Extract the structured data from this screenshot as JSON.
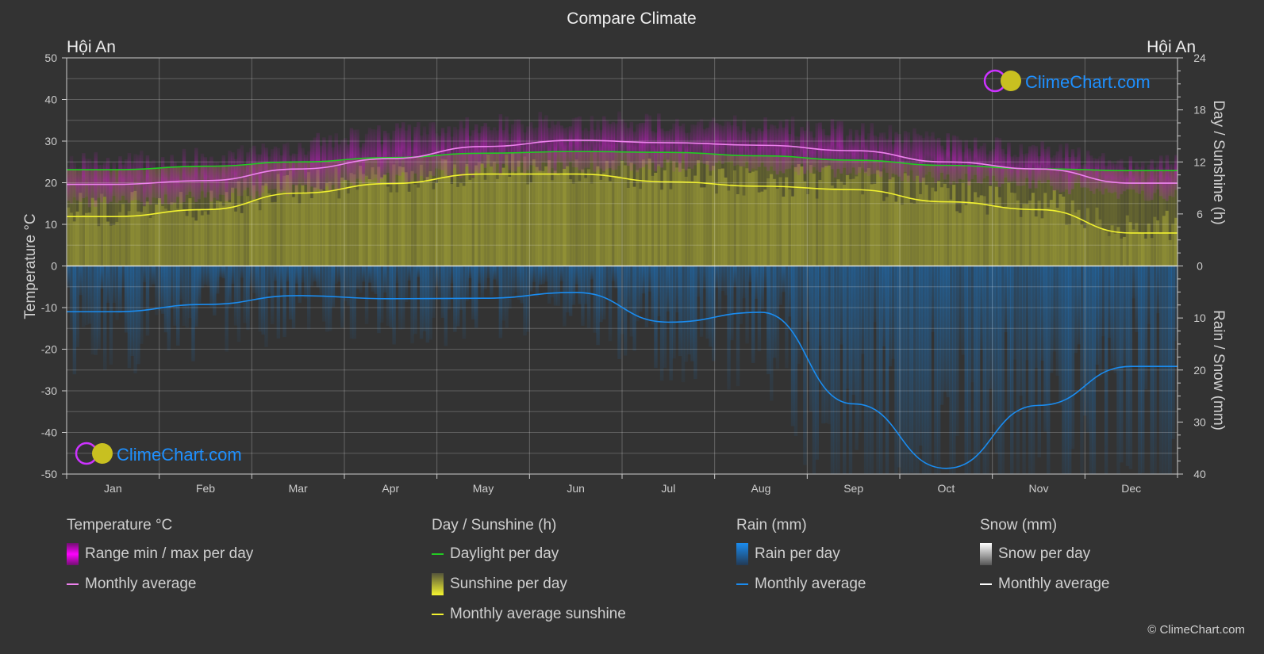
{
  "title": "Compare Climate",
  "location_left": "Hội An",
  "location_right": "Hội An",
  "watermark": "ClimeChart.com",
  "copyright": "© ClimeChart.com",
  "colors": {
    "background": "#333333",
    "temp_range": "#e000e0",
    "temp_avg": "#ee82ee",
    "daylight": "#22cc22",
    "sunshine_fill": "#d8d83a",
    "sunshine_avg": "#f2f230",
    "rain_fill": "#1e78c8",
    "rain_avg": "#1a8cf0",
    "snow_avg": "#ffffff",
    "brand_blue": "#1e90ff"
  },
  "legend": {
    "temperature": {
      "title": "Temperature °C",
      "items": [
        "Range min / max per day",
        "Monthly average"
      ]
    },
    "sunshine": {
      "title": "Day / Sunshine (h)",
      "items": [
        "Daylight per day",
        "Sunshine per day",
        "Monthly average sunshine"
      ]
    },
    "rain": {
      "title": "Rain (mm)",
      "items": [
        "Rain per day",
        "Monthly average"
      ]
    },
    "snow": {
      "title": "Snow (mm)",
      "items": [
        "Snow per day",
        "Monthly average"
      ]
    }
  },
  "chart_data": {
    "type": "line",
    "title": "Compare Climate",
    "categories": [
      "Jan",
      "Feb",
      "Mar",
      "Apr",
      "May",
      "Jun",
      "Jul",
      "Aug",
      "Sep",
      "Oct",
      "Nov",
      "Dec"
    ],
    "left_axis": {
      "label": "Temperature °C",
      "range": [
        -50,
        50
      ],
      "ticks": [
        "50",
        "40",
        "30",
        "20",
        "10",
        "0",
        "-10",
        "-20",
        "-30",
        "-40",
        "-50"
      ]
    },
    "right_axis_top": {
      "label": "Day / Sunshine (h)",
      "range": [
        0,
        24
      ],
      "ticks": [
        "24",
        "18",
        "12",
        "6",
        "0"
      ]
    },
    "right_axis_bottom": {
      "label": "Rain / Snow (mm)",
      "range": [
        0,
        40
      ],
      "ticks": [
        "10",
        "20",
        "30",
        "40"
      ]
    },
    "grid": true,
    "series": [
      {
        "name": "Temperature monthly average (°C)",
        "axis": "temp",
        "values": [
          19.6,
          20.5,
          23.3,
          25.8,
          28.7,
          30.2,
          29.6,
          29.0,
          27.7,
          25.0,
          23.3,
          19.9
        ]
      },
      {
        "name": "Temperature daily max approx (°C)",
        "axis": "temp",
        "values": [
          24,
          25,
          28,
          31,
          33,
          34,
          33.5,
          33,
          31.5,
          29,
          27,
          24
        ]
      },
      {
        "name": "Temperature daily min approx (°C)",
        "axis": "temp",
        "values": [
          17,
          18,
          20,
          22.5,
          24.5,
          25.5,
          25.5,
          25,
          24,
          22.5,
          21,
          18.5
        ]
      },
      {
        "name": "Daylight per day (h)",
        "axis": "sun",
        "values": [
          11.1,
          11.5,
          12.0,
          12.5,
          13.0,
          13.2,
          13.1,
          12.7,
          12.2,
          11.6,
          11.2,
          11.0
        ]
      },
      {
        "name": "Monthly average sunshine (h)",
        "axis": "sun",
        "values": [
          5.7,
          6.5,
          8.4,
          9.5,
          10.6,
          10.6,
          9.7,
          9.2,
          8.8,
          7.4,
          6.5,
          3.8
        ]
      },
      {
        "name": "Rain monthly average (mm)",
        "axis": "rain",
        "values": [
          8.8,
          7.4,
          5.7,
          6.3,
          6.2,
          5.1,
          10.8,
          8.9,
          26.5,
          38.9,
          26.8,
          19.3
        ]
      },
      {
        "name": "Snow monthly average (mm)",
        "axis": "rain",
        "values": [
          0,
          0,
          0,
          0,
          0,
          0,
          0,
          0,
          0,
          0,
          0,
          0
        ]
      }
    ]
  }
}
